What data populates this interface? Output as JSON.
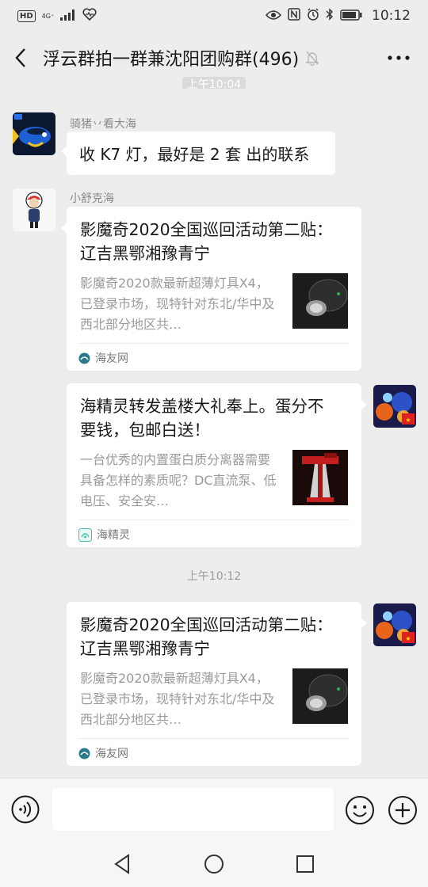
{
  "status_bar": {
    "hd": "HD",
    "network": "4G⁺",
    "time": "10:12"
  },
  "header": {
    "title": "浮云群拍一群兼沈阳团购群(496)",
    "partial_time": "上午10:04"
  },
  "messages": [
    {
      "sender": "骑猪丷看大海",
      "text": "收 K7 灯，最好是 2 套 出的联系"
    },
    {
      "sender": "小舒克海",
      "card": {
        "title": "影魔奇2020全国巡回活动第二贴： 辽吉黑鄂湘豫青宁",
        "desc": "影魔奇2020款最新超薄灯具X4，已登录市场，现特针对东北/华中及西北部分地区共…",
        "source": "海友网"
      }
    },
    {
      "card": {
        "title": "海精灵转发盖楼大礼奉上。蛋分不要钱，包邮白送！",
        "desc": "一台优秀的内置蛋白质分离器需要具备怎样的素质呢？DC直流泵、低电压、安全安…",
        "source": "海精灵"
      }
    },
    {
      "time_divider": "上午10:12"
    },
    {
      "card": {
        "title": "影魔奇2020全国巡回活动第二贴： 辽吉黑鄂湘豫青宁",
        "desc": "影魔奇2020款最新超薄灯具X4，已登录市场，现特针对东北/华中及西北部分地区共…",
        "source": "海友网"
      }
    }
  ],
  "input": {
    "placeholder": ""
  },
  "colors": {
    "background": "#ededed",
    "bubble": "#ffffff",
    "meta_text": "#8a8a8a",
    "desc_text": "#9a9a9a"
  }
}
